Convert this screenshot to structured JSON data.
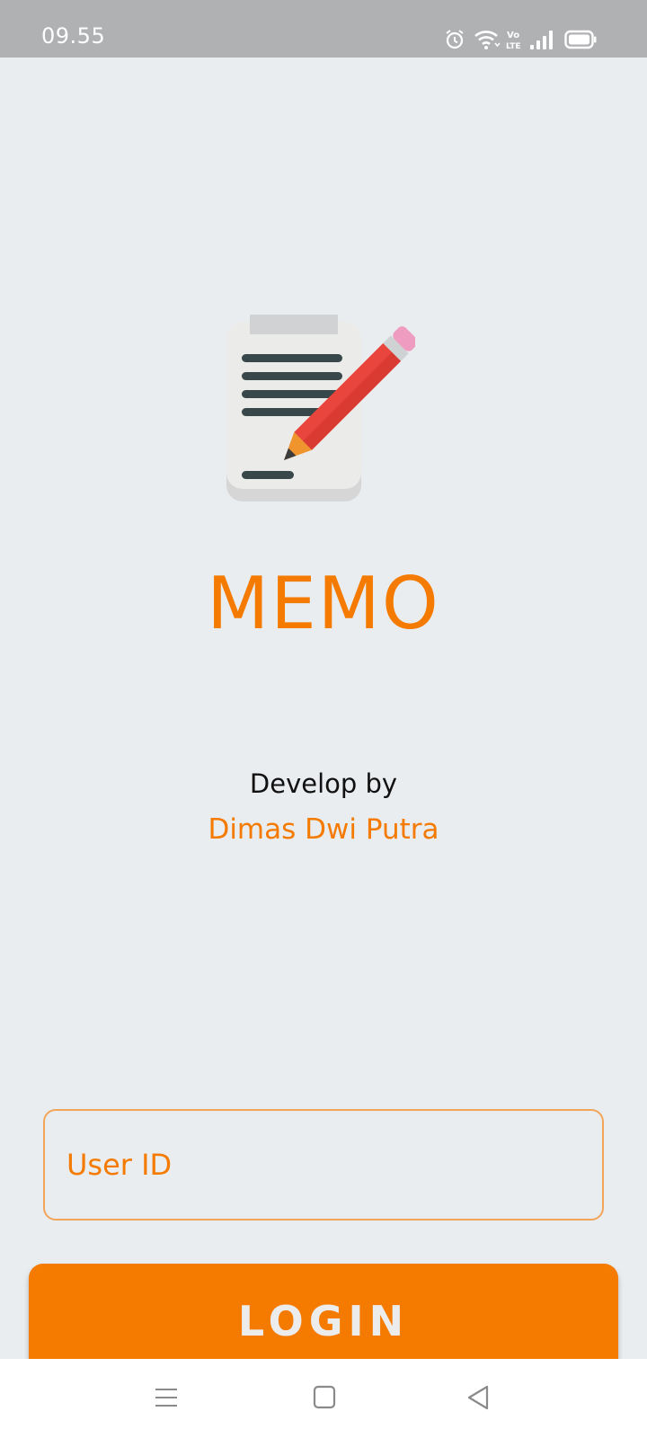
{
  "status_bar": {
    "time": "09.55",
    "icons": [
      "alarm-icon",
      "wifi-icon",
      "volte-icon",
      "signal-icon",
      "battery-icon"
    ]
  },
  "app": {
    "title": "MEMO",
    "developer_label": "Develop by",
    "developer_name": "Dimas Dwi Putra",
    "accent_color": "#f47a00"
  },
  "login_form": {
    "user_id_placeholder": "User ID",
    "user_id_value": "",
    "login_label": "LOGIN"
  },
  "nav_bar": {
    "icons": [
      "menu-icon",
      "home-icon",
      "back-icon"
    ]
  }
}
